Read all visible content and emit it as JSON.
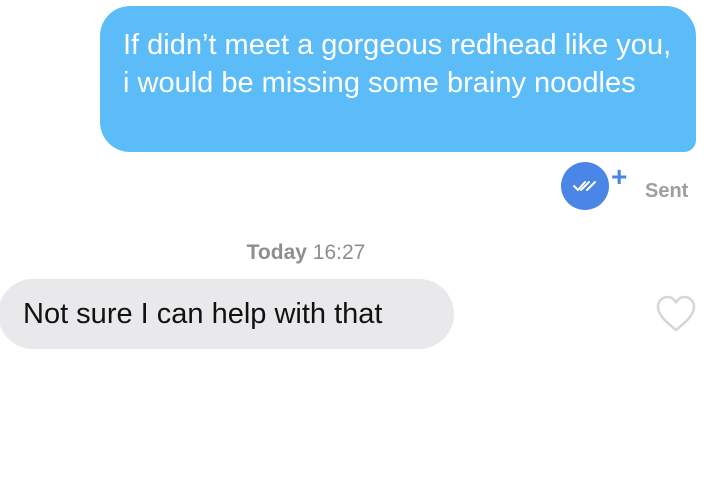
{
  "messages": {
    "outgoing": {
      "text": "If didn’t meet a gorgeous redhead like you, i would be missing some brainy noodles",
      "status": "Sent",
      "receipt_plus": "+",
      "color": "#5bbcf8"
    },
    "divider": {
      "day": "Today",
      "time": "16:27"
    },
    "incoming": {
      "text": "Not sure I can help with that",
      "color": "#e9e9eb"
    }
  },
  "icons": {
    "receipt": "double-check-icon",
    "like": "heart-outline-icon"
  },
  "colors": {
    "accent": "#4a86e8",
    "muted": "#9e9e9e"
  }
}
